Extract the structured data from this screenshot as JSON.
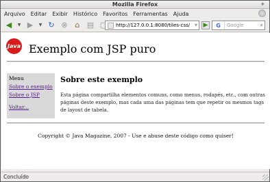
{
  "window": {
    "title": "Mozilla Firefox"
  },
  "menubar": {
    "items": [
      "Arquivo",
      "Editar",
      "Exibir",
      "Histórico",
      "Favoritos",
      "Ferramentas",
      "Ajuda"
    ]
  },
  "toolbar": {
    "icons": [
      "back-arrow-icon",
      "forward-arrow-icon",
      "reload-icon",
      "stop-icon",
      "home-icon",
      "print-icon",
      "new-tab-icon"
    ],
    "url": "http://127.0.0.1:8080/tiles-css/",
    "search_placeholder": "Google",
    "search_engine_glyph": "G"
  },
  "page": {
    "logo_text": "Java",
    "site_title": "Exemplo com JSP puro",
    "sidebar": {
      "title": "Menu",
      "links": [
        "Sobre o exemplo",
        "Sobre o JSP"
      ],
      "back_link": "Voltar..."
    },
    "main": {
      "heading": "Sobre este exemplo",
      "paragraph": "Esta página compartilha elementos comuns, como menus, rodapés, etc., com outras páginas deste exemplo, mas cada uma das páginas tem que repetir os mesmos tags de layout de tabela."
    },
    "footer": "Copyright © Java Magazine, 2007 - Use e abuse deste código como quiser!"
  },
  "statusbar": {
    "text": "Concluído"
  },
  "colors": {
    "logo": "#d81c1c",
    "link_visited": "#551a8b",
    "sidebar_bg": "#d9d9d9"
  }
}
